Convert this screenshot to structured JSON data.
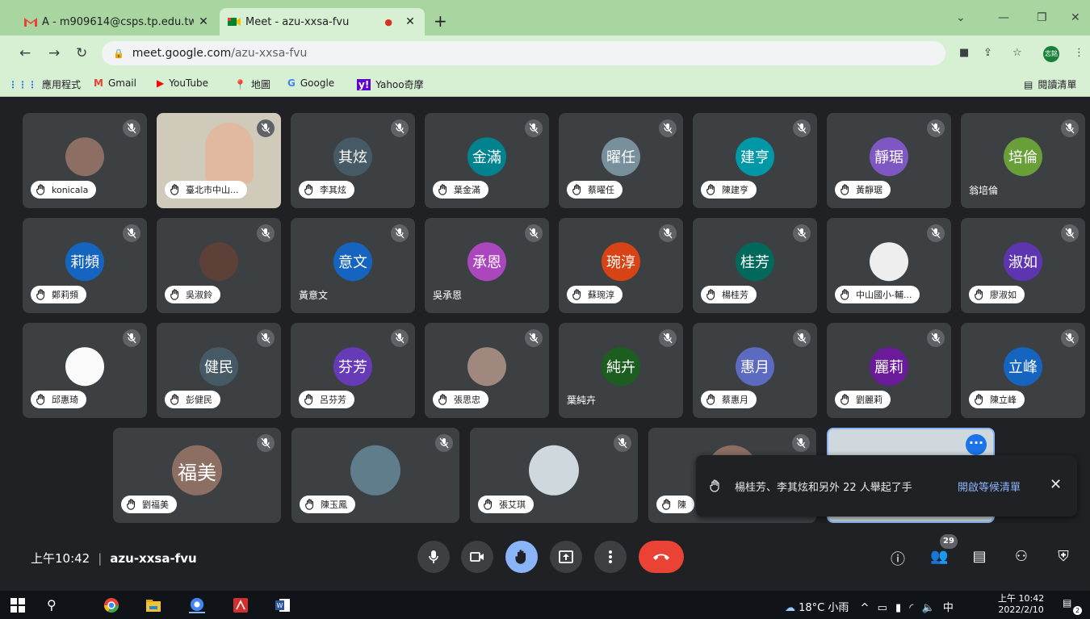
{
  "browser": {
    "tabs": [
      {
        "title": "A - m909614@csps.tp.edu.tw -",
        "close": "✕"
      },
      {
        "title": "Meet - azu-xxsa-fvu",
        "close": "✕"
      }
    ],
    "new_tab": "+",
    "url_host": "meet.google.com",
    "url_path": "/azu-xxsa-fvu",
    "profile_initials": "志銘",
    "bookmarks": [
      "應用程式",
      "Gmail",
      "YouTube",
      "地圖",
      "Google",
      "Yahoo奇摩"
    ],
    "reading_list": "閱讀清單"
  },
  "participants": [
    {
      "avatar_text": "",
      "name": "konicala",
      "label": "chip",
      "color": "#8d6e63"
    },
    {
      "avatar_text": "",
      "name": "臺北市中山...",
      "label": "chip",
      "color": "#795548"
    },
    {
      "avatar_text": "其炫",
      "name": "李其炫",
      "label": "chip",
      "color": "#455a64"
    },
    {
      "avatar_text": "金滿",
      "name": "葉金滿",
      "label": "chip",
      "color": "#00838f"
    },
    {
      "avatar_text": "曜任",
      "name": "蔡曜任",
      "label": "chip",
      "color": "#78909c"
    },
    {
      "avatar_text": "建亨",
      "name": "陳建亨",
      "label": "chip",
      "color": "#0097a7"
    },
    {
      "avatar_text": "靜琚",
      "name": "黃靜琚",
      "label": "chip",
      "color": "#7e57c2"
    },
    {
      "avatar_text": "培倫",
      "name": "翁培倫",
      "label": "plain",
      "color": "#689f38"
    },
    {
      "avatar_text": "莉頻",
      "name": "鄭莉頻",
      "label": "chip",
      "color": "#1565c0"
    },
    {
      "avatar_text": "",
      "name": "吳淑鈴",
      "label": "chip",
      "color": "#5d4037"
    },
    {
      "avatar_text": "意文",
      "name": "黃意文",
      "label": "plain",
      "color": "#1565c0"
    },
    {
      "avatar_text": "承恩",
      "name": "吳承恩",
      "label": "plain",
      "color": "#ab47bc"
    },
    {
      "avatar_text": "琬淳",
      "name": "蘇琬淳",
      "label": "chip",
      "color": "#d84315"
    },
    {
      "avatar_text": "桂芳",
      "name": "楊桂芳",
      "label": "chip",
      "color": "#00695c"
    },
    {
      "avatar_text": "",
      "name": "中山國小-輔...",
      "label": "chip",
      "color": "#eeeeee"
    },
    {
      "avatar_text": "淑如",
      "name": "廖淑如",
      "label": "chip",
      "color": "#5e35b1"
    },
    {
      "avatar_text": "",
      "name": "邱惠琦",
      "label": "chip",
      "color": "#fafafa"
    },
    {
      "avatar_text": "健民",
      "name": "彭健民",
      "label": "chip",
      "color": "#455a64"
    },
    {
      "avatar_text": "芬芳",
      "name": "呂芬芳",
      "label": "chip",
      "color": "#673ab7"
    },
    {
      "avatar_text": "",
      "name": "張思忠",
      "label": "chip",
      "color": "#a1887f"
    },
    {
      "avatar_text": "純卉",
      "name": "葉純卉",
      "label": "plain",
      "color": "#1b5e20"
    },
    {
      "avatar_text": "惠月",
      "name": "蔡惠月",
      "label": "chip",
      "color": "#5c6bc0"
    },
    {
      "avatar_text": "麗莉",
      "name": "劉麗莉",
      "label": "chip",
      "color": "#6a1b9a"
    },
    {
      "avatar_text": "立峰",
      "name": "陳立峰",
      "label": "chip",
      "color": "#1565c0"
    },
    {
      "avatar_text": "福美",
      "name": "劉福美",
      "label": "chip",
      "color": "#8d6e63"
    },
    {
      "avatar_text": "",
      "name": "陳玉鳳",
      "label": "chip",
      "color": "#607d8b"
    },
    {
      "avatar_text": "",
      "name": "張艾琪",
      "label": "chip",
      "color": "#cfd8dc"
    },
    {
      "avatar_text": "",
      "name": "陳",
      "label": "chip",
      "color": "#8d6e63"
    }
  ],
  "notification": {
    "text": "楊桂芳、李其炫和另外 22 人舉起了手",
    "action": "開啟等候清單",
    "close": "✕"
  },
  "meeting": {
    "time": "上午10:42",
    "separator": "|",
    "code": "azu-xxsa-fvu",
    "people_count": "29"
  },
  "colors": {
    "meet_background": "#202124",
    "tile": "#3c4043",
    "end_call": "#ea4335",
    "raised_hand_active": "#8ab4f8",
    "chrome_frame": "#a8d5a0"
  },
  "taskbar": {
    "weather": "18°C 小雨",
    "ime": "中",
    "time": "上午 10:42",
    "date": "2022/2/10",
    "notifications": "2"
  }
}
